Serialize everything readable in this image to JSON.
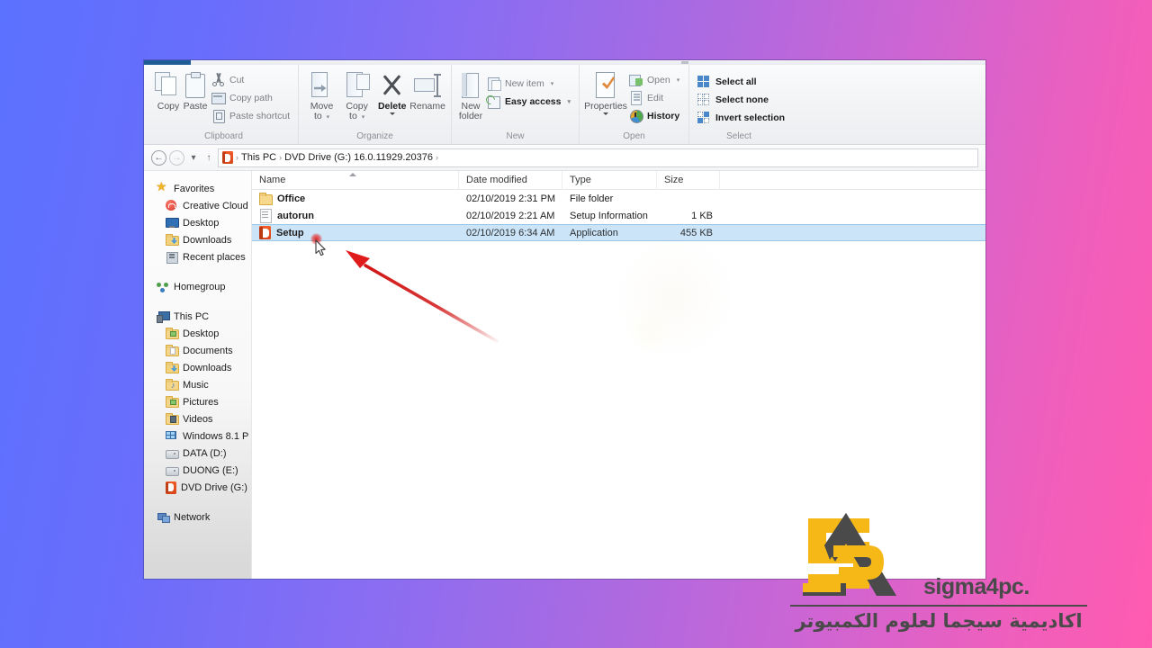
{
  "desktop": {
    "background_from": "#5b71ff",
    "background_to": "#ff5bb0"
  },
  "ribbon": {
    "groups": [
      {
        "label": "Clipboard",
        "big_buttons": [
          {
            "label": "Copy",
            "icon": "copy-icon",
            "enabled": false
          },
          {
            "label": "Paste",
            "icon": "paste-icon",
            "enabled": false
          }
        ],
        "small_buttons": [
          {
            "label": "Cut",
            "icon": "scissors-icon",
            "enabled": false
          },
          {
            "label": "Copy path",
            "icon": "copy-path-icon",
            "enabled": false
          },
          {
            "label": "Paste shortcut",
            "icon": "paste-shortcut-icon",
            "enabled": false
          }
        ]
      },
      {
        "label": "Organize",
        "big_buttons": [
          {
            "label": "Move\nto",
            "label_line1": "Move",
            "label_line2": "to",
            "icon": "move-to-icon",
            "enabled": false,
            "has_caret": true
          },
          {
            "label": "Copy\nto",
            "label_line1": "Copy",
            "label_line2": "to",
            "icon": "copy-to-icon",
            "enabled": false,
            "has_caret": true
          },
          {
            "label": "Delete",
            "icon": "delete-icon",
            "enabled": true,
            "has_dropdown_dot": true
          },
          {
            "label": "Rename",
            "icon": "rename-icon",
            "enabled": false
          }
        ]
      },
      {
        "label": "New",
        "big_buttons": [
          {
            "label_line1": "New",
            "label_line2": "folder",
            "icon": "new-folder-icon",
            "enabled": false
          }
        ],
        "small_buttons": [
          {
            "label": "New item",
            "icon": "new-item-icon",
            "enabled": false,
            "caret": "▾"
          },
          {
            "label": "Easy access",
            "icon": "easy-access-icon",
            "enabled": true,
            "caret": "▾"
          }
        ]
      },
      {
        "label": "Open",
        "big_buttons": [
          {
            "label": "Properties",
            "icon": "properties-icon",
            "enabled": false,
            "has_dropdown_dot": true
          }
        ],
        "small_buttons": [
          {
            "label": "Open",
            "icon": "open-icon",
            "enabled": false,
            "caret": "▾"
          },
          {
            "label": "Edit",
            "icon": "edit-icon",
            "enabled": false
          },
          {
            "label": "History",
            "icon": "history-icon",
            "enabled": true
          }
        ]
      },
      {
        "label": "Select",
        "small_buttons": [
          {
            "label": "Select all",
            "icon": "select-all-icon",
            "enabled": true
          },
          {
            "label": "Select none",
            "icon": "select-none-icon",
            "enabled": true
          },
          {
            "label": "Invert selection",
            "icon": "invert-selection-icon",
            "enabled": true
          }
        ]
      }
    ]
  },
  "address_bar": {
    "back_glyph": "←",
    "forward_glyph": "→",
    "recent_glyph": "▾",
    "up_glyph": "↑",
    "drive_icon": "office-dvd-icon",
    "crumbs": [
      "This PC",
      "DVD Drive (G:) 16.0.11929.20376"
    ],
    "separator": "›",
    "trailing_separator": "›"
  },
  "nav_pane": {
    "items": [
      {
        "label": "Favorites",
        "icon": "star-icon",
        "level": 0
      },
      {
        "label": "Creative Cloud",
        "icon": "creative-cloud-icon",
        "level": 1
      },
      {
        "label": "Desktop",
        "icon": "desktop-icon",
        "level": 1
      },
      {
        "label": "Downloads",
        "icon": "downloads-folder-icon",
        "level": 1
      },
      {
        "label": "Recent places",
        "icon": "recent-places-icon",
        "level": 1
      },
      {
        "label": "",
        "icon": "spacer",
        "level": -1
      },
      {
        "label": "Homegroup",
        "icon": "homegroup-icon",
        "level": 0
      },
      {
        "label": "",
        "icon": "spacer",
        "level": -1
      },
      {
        "label": "This PC",
        "icon": "this-pc-icon",
        "level": 0
      },
      {
        "label": "Desktop",
        "icon": "desktop-folder-icon",
        "level": 1
      },
      {
        "label": "Documents",
        "icon": "documents-folder-icon",
        "level": 1
      },
      {
        "label": "Downloads",
        "icon": "downloads-folder-icon",
        "level": 1
      },
      {
        "label": "Music",
        "icon": "music-folder-icon",
        "level": 1
      },
      {
        "label": "Pictures",
        "icon": "pictures-folder-icon",
        "level": 1
      },
      {
        "label": "Videos",
        "icon": "videos-folder-icon",
        "level": 1
      },
      {
        "label": "Windows 8.1 P",
        "icon": "windows-drive-icon",
        "level": 1
      },
      {
        "label": "DATA (D:)",
        "icon": "drive-icon",
        "level": 1
      },
      {
        "label": "DUONG (E:)",
        "icon": "drive-icon",
        "level": 1
      },
      {
        "label": "DVD Drive (G:)",
        "icon": "office-dvd-icon",
        "level": 1
      },
      {
        "label": "",
        "icon": "spacer",
        "level": -1
      },
      {
        "label": "Network",
        "icon": "network-icon",
        "level": 0
      }
    ]
  },
  "file_list": {
    "columns": [
      {
        "label": "Name",
        "key": "name"
      },
      {
        "label": "Date modified",
        "key": "date"
      },
      {
        "label": "Type",
        "key": "type"
      },
      {
        "label": "Size",
        "key": "size"
      }
    ],
    "sort_column": "Name",
    "sort_direction": "ascending",
    "rows": [
      {
        "name": "Office",
        "date": "02/10/2019 2:31 PM",
        "type": "File folder",
        "size": "",
        "icon": "folder-icon",
        "selected": false
      },
      {
        "name": "autorun",
        "date": "02/10/2019 2:21 AM",
        "type": "Setup Information",
        "size": "1 KB",
        "icon": "inf-file-icon",
        "selected": false
      },
      {
        "name": "Setup",
        "date": "02/10/2019 6:34 AM",
        "type": "Application",
        "size": "455 KB",
        "icon": "office-setup-icon",
        "selected": true
      }
    ]
  },
  "status_bar": {
    "text": ""
  },
  "annotations": {
    "arrow_color": "#e01b1b",
    "click_marker_color": "#e21e1e",
    "cursor": "arrow-pointer"
  },
  "watermark": {
    "brand": "sigma4pc.",
    "arabic": "اكاديمية سيجما لعلوم الكمبيوتر",
    "logo_yellow": "#f5b817",
    "logo_dark": "#4a4a4a"
  }
}
